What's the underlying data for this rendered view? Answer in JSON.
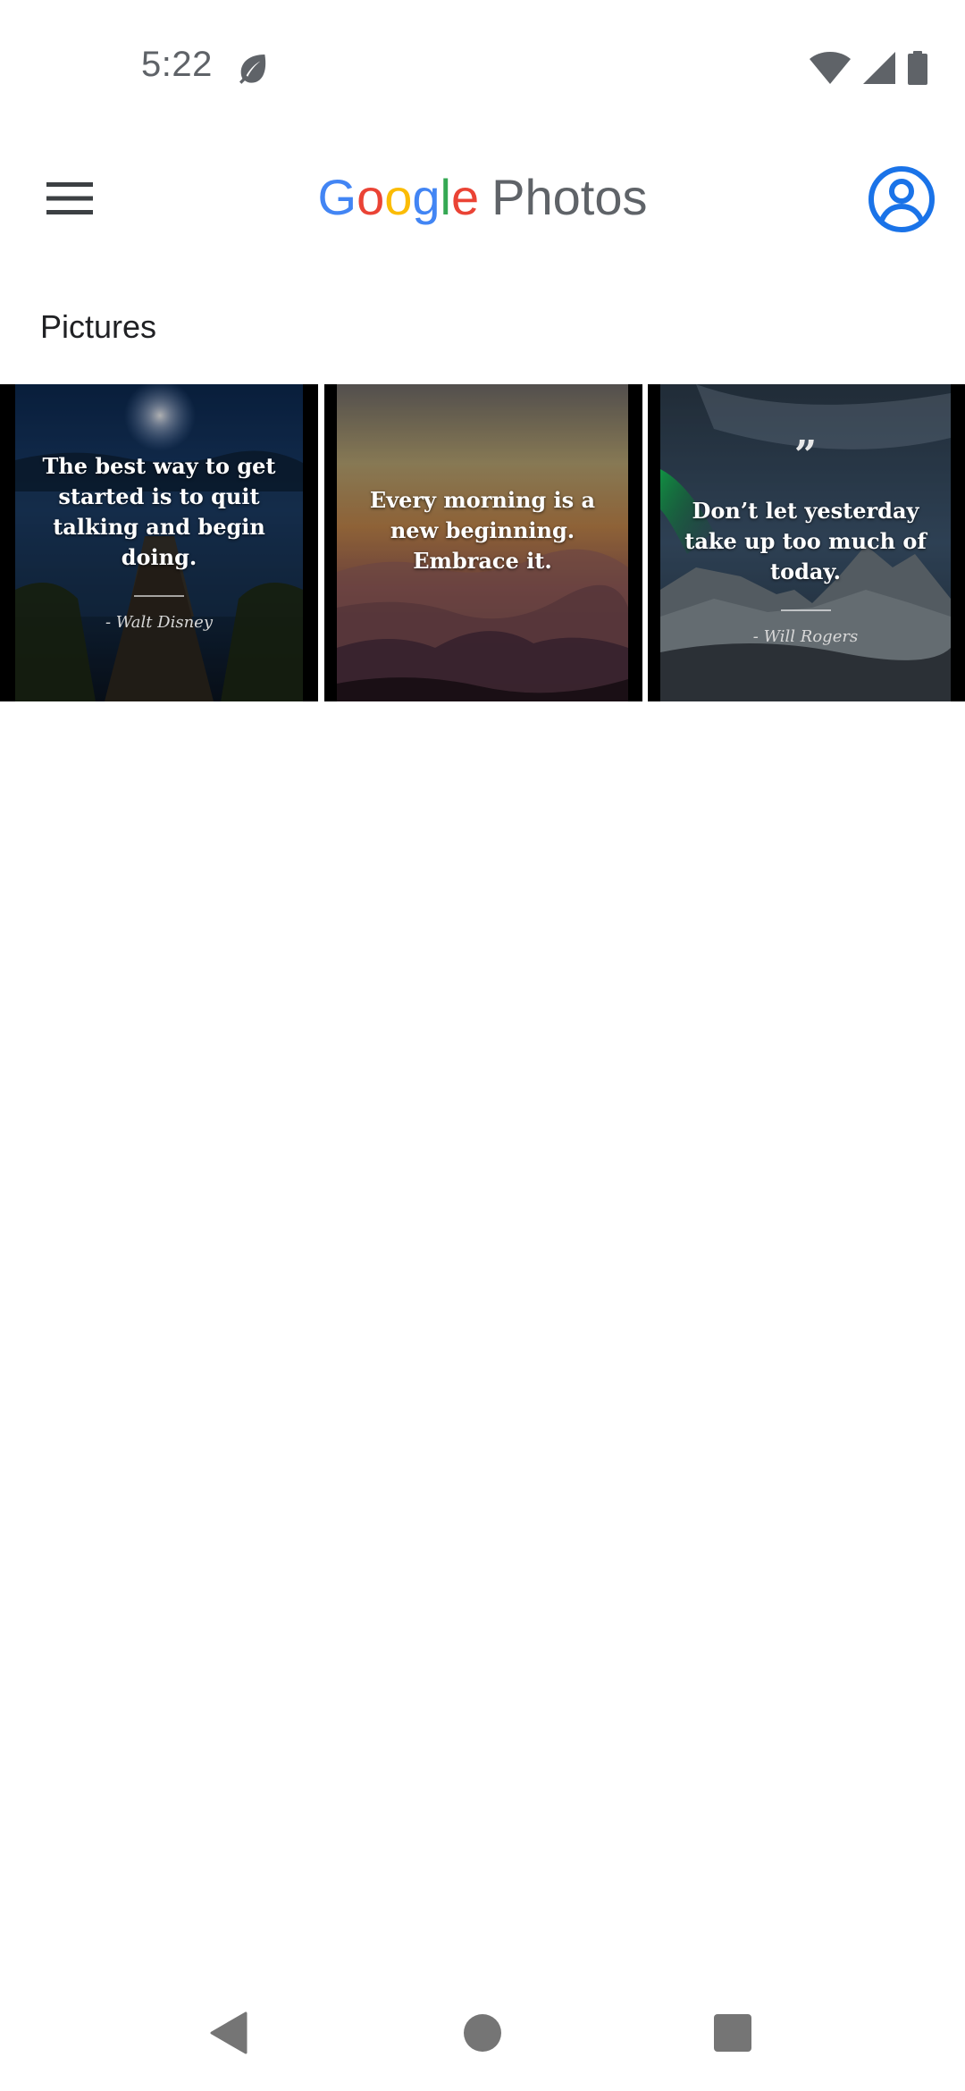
{
  "status_bar": {
    "time": "5:22",
    "icons": [
      "leaf-icon",
      "wifi-icon",
      "signal-icon",
      "battery-icon"
    ]
  },
  "app_bar": {
    "menu_icon": "hamburger-menu-icon",
    "logo_google": "Google",
    "logo_product": "Photos",
    "account_icon": "account-circle-icon"
  },
  "section": {
    "title": "Pictures"
  },
  "photos": [
    {
      "quote": "The best way to get started is to quit talking and begin doing.",
      "author": "- Walt Disney"
    },
    {
      "quote": "Every morning is a new beginning. Embrace it.",
      "author": ""
    },
    {
      "quote_mark": "”",
      "quote": "Don’t let yesterday take up too much of today.",
      "author": "- Will Rogers"
    }
  ],
  "nav_bar": {
    "icons": [
      "back-icon",
      "home-icon",
      "recents-icon"
    ]
  },
  "colors": {
    "google_blue": "#4285F4",
    "google_red": "#EA4335",
    "google_yellow": "#FBBC05",
    "google_green": "#34A853",
    "account_blue": "#1a73e8",
    "system_icon_gray": "#5f6368"
  }
}
